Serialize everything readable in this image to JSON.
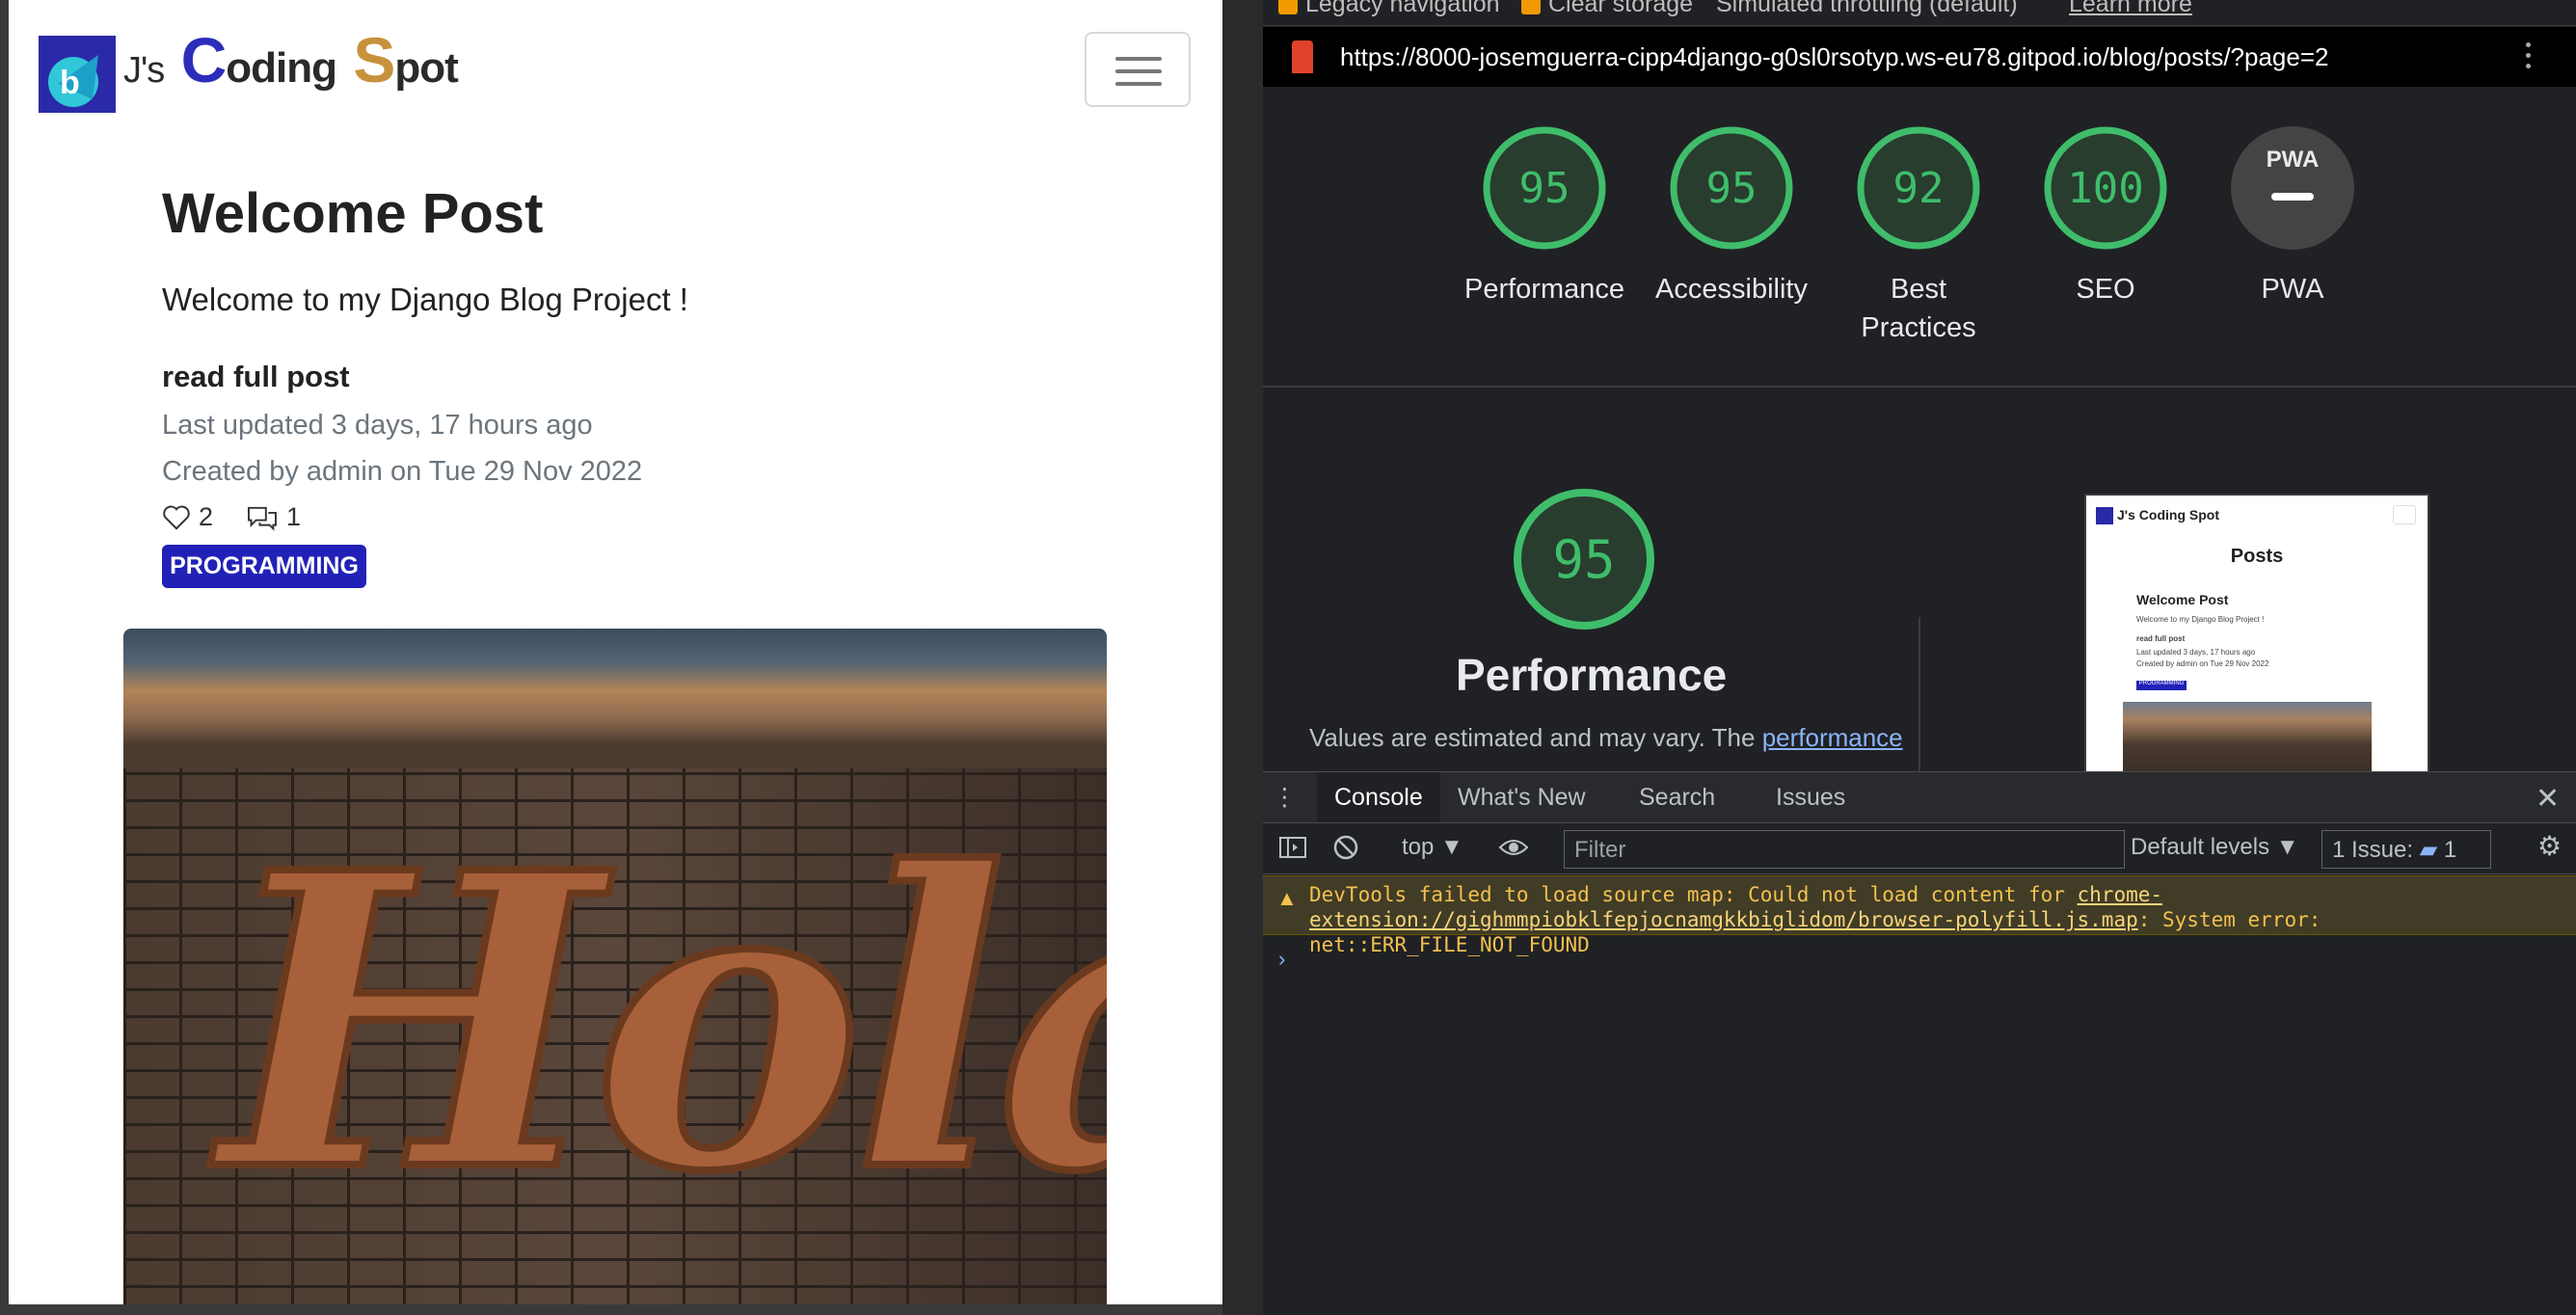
{
  "site": {
    "brand_js": "J's",
    "brand_c": "C",
    "brand_oding": "oding",
    "brand_s": "S",
    "brand_pot": "pot"
  },
  "post": {
    "title": "Welcome Post",
    "excerpt": "Welcome to my Django Blog Project !",
    "read_full": "read full post",
    "updated": "Last updated 3 days, 17 hours ago",
    "created": "Created by admin on Tue 29 Nov 2022",
    "likes": "2",
    "comments": "1",
    "category": "PROGRAMMING",
    "image_text": "Hola"
  },
  "lighthouse": {
    "top_options": [
      "Legacy navigation",
      "Clear storage",
      "Simulated throttling (default)",
      "Learn more"
    ],
    "url": "https://8000-josemguerra-cipp4django-g0sl0rsotyp.ws-eu78.gitpod.io/blog/posts/?page=2",
    "scores": [
      {
        "label": "Performance",
        "value": 95
      },
      {
        "label": "Accessibility",
        "value": 95
      },
      {
        "label": "Best Practices",
        "value": 92
      },
      {
        "label": "SEO",
        "value": 100
      },
      {
        "label": "PWA",
        "value": "PWA"
      }
    ],
    "perf_score": "95",
    "perf_title": "Performance",
    "perf_desc_prefix": "Values are estimated and may vary. The ",
    "perf_desc_link": "performance",
    "thumbnail": {
      "brand": "J's Coding Spot",
      "heading": "Posts",
      "post_title": "Welcome Post",
      "line1": "Welcome to my Django Blog Project !",
      "line2": "read full post",
      "line3": "Last updated 3 days, 17 hours ago",
      "line4": "Created by admin on Tue 29 Nov 2022",
      "line5": "PROGRAMMING"
    },
    "colors": {
      "good": "#3fbd6b",
      "pwa_bg": "#444"
    }
  },
  "devtools": {
    "tabs": [
      "Console",
      "What's New",
      "Search",
      "Issues"
    ],
    "context": "top",
    "filter_placeholder": "Filter",
    "levels": "Default levels",
    "issues_label": "1 Issue:",
    "issues_count": "1",
    "warning": {
      "prefix": "DevTools failed to load source map: Could not load content for ",
      "link": "chrome-extension://gighmmpiobklfepjocnamgkkbiglidom/browser-polyfill.js.map",
      "suffix": ": System error: net::ERR_FILE_NOT_FOUND"
    }
  }
}
